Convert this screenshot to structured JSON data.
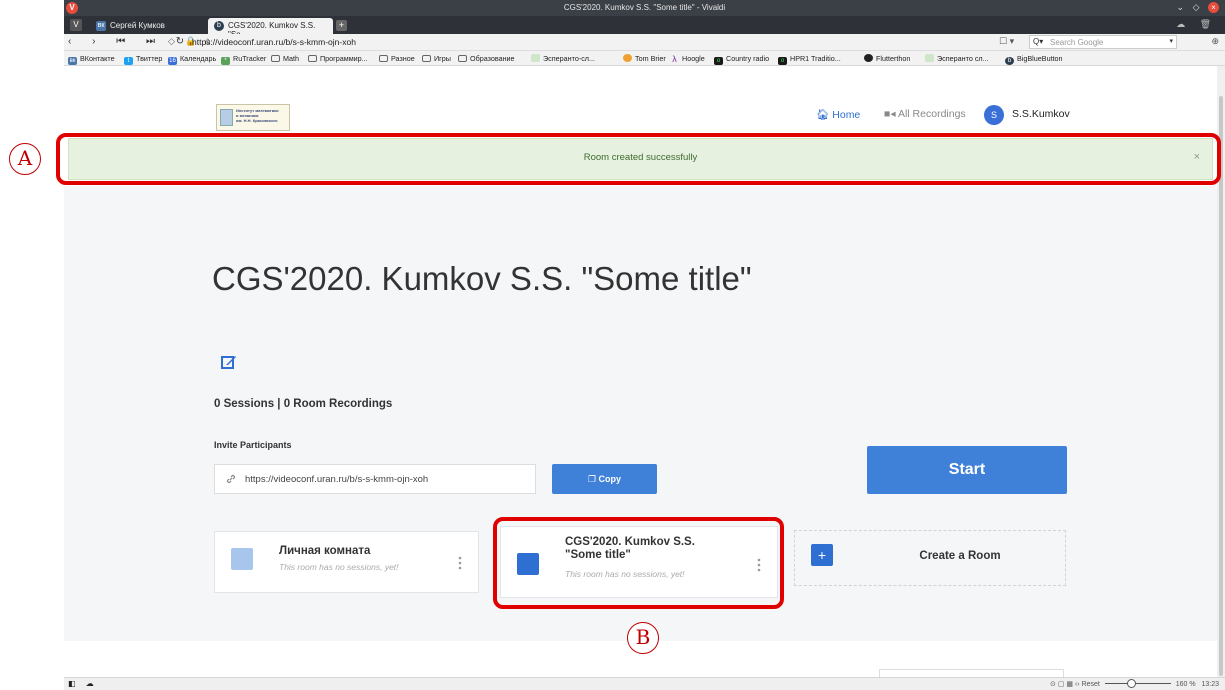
{
  "window": {
    "title": "CGS'2020. Kumkov S.S. \"Some title\" - Vivaldi"
  },
  "tabs": [
    {
      "label": "Сергей Кумков"
    },
    {
      "label": "CGS'2020. Kumkov S.S. \"So"
    }
  ],
  "address": {
    "url": "https://videoconf.uran.ru/b/s-s-kmm-ojn-xoh",
    "search_placeholder": "Search Google"
  },
  "bookmarks": [
    "ВКонтакте",
    "Твиттер",
    "Календарь",
    "RuTracker",
    "Math",
    "Программир...",
    "Разное",
    "Игры",
    "Образование",
    "Эсперанто-сл...",
    "Tom Brier",
    "Hoogle",
    "Country radio",
    "HPR1 Traditio...",
    "Flutterthon",
    "Эсперанто сл...",
    "BigBlueButton"
  ],
  "logo": {
    "line1": "Институт математики",
    "line2": "и механики",
    "line3": "им. Н.Н. Красовского"
  },
  "nav": {
    "home": "Home",
    "recordings": "All Recordings",
    "avatar_letter": "S",
    "user": "S.S.Kumkov"
  },
  "alert": {
    "message": "Room created successfully",
    "close": "×"
  },
  "room": {
    "title": "CGS'2020. Kumkov S.S. \"Some title\"",
    "stats": "0 Sessions | 0 Room Recordings",
    "invite_label": "Invite Participants",
    "invite_url": "https://videoconf.uran.ru/b/s-s-kmm-ojn-xoh",
    "copy_label": "Copy",
    "start_label": "Start"
  },
  "cards": [
    {
      "name": "Личная комната",
      "sub": "This room has no sessions, yet!"
    },
    {
      "name": "CGS'2020. Kumkov S.S. \"Some title\"",
      "sub": "This room has no sessions, yet!"
    },
    {
      "name": "Create a Room"
    }
  ],
  "annotations": {
    "a": "A",
    "b": "B",
    "color": "#e00000"
  },
  "statusbar": {
    "reset": "Reset",
    "zoom": "160 %",
    "time": "13:23"
  },
  "colors": {
    "accent": "#3f80d9",
    "alert_bg": "#e7f1e0",
    "alert_text": "#3f6b2e"
  }
}
